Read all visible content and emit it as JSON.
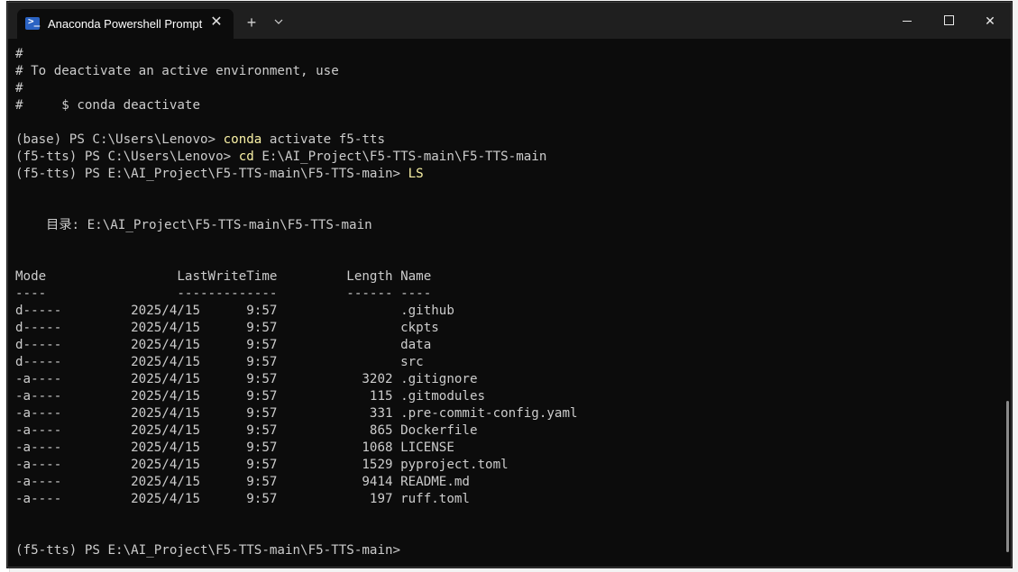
{
  "window": {
    "tab_title": "Anaconda Powershell Prompt",
    "tab_icon": "powershell-icon",
    "close_tab_label": "✕",
    "new_tab_label": "+",
    "dropdown_label": "⌄",
    "close_label": "✕",
    "accent_color": "#2b63c3"
  },
  "terminal": {
    "lines": [
      {
        "parts": [
          "#"
        ]
      },
      {
        "parts": [
          "# To deactivate an active environment, use"
        ]
      },
      {
        "parts": [
          "#"
        ]
      },
      {
        "parts": [
          "#     $ conda deactivate"
        ]
      },
      {
        "parts": [
          ""
        ]
      },
      {
        "parts": [
          "(base) PS C:\\Users\\Lenovo> ",
          "conda",
          " activate f5-tts"
        ]
      },
      {
        "parts": [
          "(f5-tts) PS C:\\Users\\Lenovo> ",
          "cd",
          " E:\\AI_Project\\F5-TTS-main\\F5-TTS-main"
        ]
      },
      {
        "parts": [
          "(f5-tts) PS E:\\AI_Project\\F5-TTS-main\\F5-TTS-main> ",
          "LS",
          ""
        ]
      },
      {
        "parts": [
          ""
        ]
      },
      {
        "parts": [
          ""
        ]
      },
      {
        "parts": [
          "    目录: E:\\AI_Project\\F5-TTS-main\\F5-TTS-main"
        ]
      },
      {
        "parts": [
          ""
        ]
      },
      {
        "parts": [
          ""
        ]
      },
      {
        "parts": [
          "Mode                 LastWriteTime         Length Name"
        ]
      },
      {
        "parts": [
          "----                 -------------         ------ ----"
        ]
      },
      {
        "parts": [
          "d-----         2025/4/15      9:57                .github"
        ]
      },
      {
        "parts": [
          "d-----         2025/4/15      9:57                ckpts"
        ]
      },
      {
        "parts": [
          "d-----         2025/4/15      9:57                data"
        ]
      },
      {
        "parts": [
          "d-----         2025/4/15      9:57                src"
        ]
      },
      {
        "parts": [
          "-a----         2025/4/15      9:57           3202 .gitignore"
        ]
      },
      {
        "parts": [
          "-a----         2025/4/15      9:57            115 .gitmodules"
        ]
      },
      {
        "parts": [
          "-a----         2025/4/15      9:57            331 .pre-commit-config.yaml"
        ]
      },
      {
        "parts": [
          "-a----         2025/4/15      9:57            865 Dockerfile"
        ]
      },
      {
        "parts": [
          "-a----         2025/4/15      9:57           1068 LICENSE"
        ]
      },
      {
        "parts": [
          "-a----         2025/4/15      9:57           1529 pyproject.toml"
        ]
      },
      {
        "parts": [
          "-a----         2025/4/15      9:57           9414 README.md"
        ]
      },
      {
        "parts": [
          "-a----         2025/4/15      9:57            197 ruff.toml"
        ]
      },
      {
        "parts": [
          ""
        ]
      },
      {
        "parts": [
          ""
        ]
      },
      {
        "parts": [
          "(f5-tts) PS E:\\AI_Project\\F5-TTS-main\\F5-TTS-main> "
        ]
      }
    ]
  },
  "colors": {
    "terminal_bg": "#0c0c0c",
    "text": "#cccccc",
    "command_highlight": "#f9f1a5"
  }
}
